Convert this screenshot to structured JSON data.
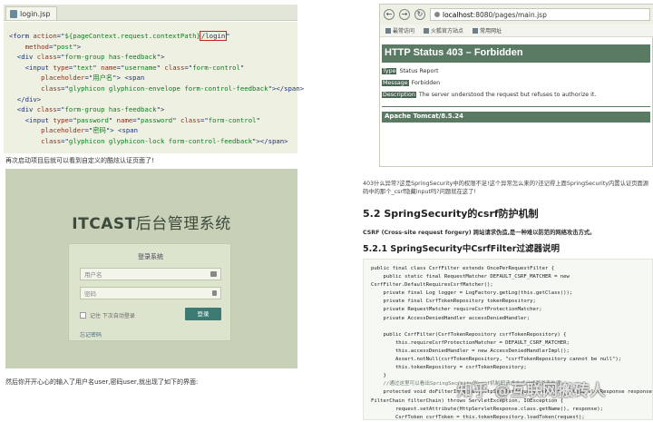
{
  "left": {
    "tab_label": "login.jsp",
    "code_lines": [
      {
        "indent": "",
        "tokens": [
          [
            "tag",
            "<form "
          ],
          [
            "attr",
            "action"
          ],
          [
            "tag",
            "=\""
          ],
          [
            "str",
            "${pageContext.request.contextPath}"
          ],
          [
            "hl",
            "/login"
          ],
          [
            "tag",
            "\""
          ]
        ]
      },
      {
        "indent": "    ",
        "tokens": [
          [
            "attr",
            "method"
          ],
          [
            "tag",
            "=\""
          ],
          [
            "str",
            "post"
          ],
          [
            "tag",
            "\">"
          ]
        ]
      },
      {
        "indent": "  ",
        "tokens": [
          [
            "tag",
            "<div "
          ],
          [
            "attr",
            "class"
          ],
          [
            "tag",
            "=\""
          ],
          [
            "str",
            "form-group has-feedback"
          ],
          [
            "tag",
            "\">"
          ]
        ]
      },
      {
        "indent": "    ",
        "tokens": [
          [
            "tag",
            "<input "
          ],
          [
            "attr",
            "type"
          ],
          [
            "tag",
            "=\""
          ],
          [
            "str",
            "text"
          ],
          [
            "tag",
            "\" "
          ],
          [
            "attr",
            "name"
          ],
          [
            "tag",
            "=\""
          ],
          [
            "str",
            "username"
          ],
          [
            "tag",
            "\" "
          ],
          [
            "attr",
            "class"
          ],
          [
            "tag",
            "=\""
          ],
          [
            "str",
            "form-control"
          ],
          [
            "tag",
            "\""
          ]
        ]
      },
      {
        "indent": "        ",
        "tokens": [
          [
            "attr",
            "placeholder"
          ],
          [
            "tag",
            "=\""
          ],
          [
            "str",
            "用户名"
          ],
          [
            "tag",
            "\"> <span"
          ]
        ]
      },
      {
        "indent": "        ",
        "tokens": [
          [
            "attr",
            "class"
          ],
          [
            "tag",
            "=\""
          ],
          [
            "str",
            "glyphicon glyphicon-envelope form-control-feedback"
          ],
          [
            "tag",
            "\"></span>"
          ]
        ]
      },
      {
        "indent": "  ",
        "tokens": [
          [
            "tag",
            "</div>"
          ]
        ]
      },
      {
        "indent": "  ",
        "tokens": [
          [
            "tag",
            "<div "
          ],
          [
            "attr",
            "class"
          ],
          [
            "tag",
            "=\""
          ],
          [
            "str",
            "form-group has-feedback"
          ],
          [
            "tag",
            "\">"
          ]
        ]
      },
      {
        "indent": "    ",
        "tokens": [
          [
            "tag",
            "<input "
          ],
          [
            "attr",
            "type"
          ],
          [
            "tag",
            "=\""
          ],
          [
            "str",
            "password"
          ],
          [
            "tag",
            "\" "
          ],
          [
            "attr",
            "name"
          ],
          [
            "tag",
            "=\""
          ],
          [
            "str",
            "password"
          ],
          [
            "tag",
            "\" "
          ],
          [
            "attr",
            "class"
          ],
          [
            "tag",
            "=\""
          ],
          [
            "str",
            "form-control"
          ],
          [
            "tag",
            "\""
          ]
        ]
      },
      {
        "indent": "        ",
        "tokens": [
          [
            "attr",
            "placeholder"
          ],
          [
            "tag",
            "=\""
          ],
          [
            "str",
            "密码"
          ],
          [
            "tag",
            "\"> <span"
          ]
        ]
      },
      {
        "indent": "        ",
        "tokens": [
          [
            "attr",
            "class"
          ],
          [
            "tag",
            "=\""
          ],
          [
            "str",
            "glyphicon glyphicon-lock form-control-feedback"
          ],
          [
            "tag",
            "\"></span>"
          ]
        ]
      }
    ],
    "caption_top": "再次启动项目后就可以看到自定义的酷炫认证页面了!",
    "login": {
      "brand_bold": "ITCAST",
      "brand_rest": "后台管理系统",
      "box_title": "登录系统",
      "username_placeholder": "用户名",
      "password_placeholder": "密码",
      "remember_label": "记住 下次自动登录",
      "login_button": "登录",
      "forgot_link": "忘记密码"
    },
    "caption_bottom": "然后你开开心心的输入了用户名user,密码user,就出现了如下的界面:"
  },
  "right": {
    "browser": {
      "back": "←",
      "forward": "→",
      "reload": "↻",
      "url_domain": "localhost",
      "url_rest": ":8080/pages/main.jsp",
      "bookmarks": [
        "最常访问",
        "火狐官方站点",
        "常用网址"
      ]
    },
    "error": {
      "title": "HTTP Status 403 – Forbidden",
      "type_label": "Type",
      "type_value": "Status Report",
      "message_label": "Message",
      "message_value": "Forbidden",
      "description_label": "Description",
      "description_value": "The server understood the request but refuses to authorize it.",
      "footer": "Apache Tomcat/8.5.24"
    },
    "paragraph": "403什么异常?这是SpringSecurity中的权限不足!这个异常怎么来的?还记得上面SpringSecurity内置认证页面源码中的那个_csrf隐藏input吗?问题就在这了!",
    "h52": "5.2 SpringSecurity的csrf防护机制",
    "csrf_def": "CSRF (Cross-site request forgery) 跨站请求伪造,是一种难以防范的网络攻击方式。",
    "h521": "5.2.1 SpringSecurity中CsrfFilter过滤器说明",
    "java_lines": [
      "public final class CsrfFilter extends OncePerRequestFilter {",
      "    public static final RequestMatcher DEFAULT_CSRF_MATCHER = new",
      "CsrfFilter.DefaultRequiresCsrfMatcher();",
      "    private final Log logger = LogFactory.getLog(this.getClass());",
      "    private final CsrfTokenRepository tokenRepository;",
      "    private RequestMatcher requireCsrfProtectionMatcher;",
      "    private AccessDeniedHandler accessDeniedHandler;",
      "",
      "    public CsrfFilter(CsrfTokenRepository csrfTokenRepository) {",
      "        this.requireCsrfProtectionMatcher = DEFAULT_CSRF_MATCHER;",
      "        this.accessDeniedHandler = new AccessDeniedHandlerImpl();",
      "        Assert.notNull(csrfTokenRepository, \"csrfTokenRepository cannot be null\");",
      "        this.tokenRepository = csrfTokenRepository;",
      "    }",
      "    //通过这里可以看出SpringSecurity的csrf机制把请求方式分成两类来处理",
      "    protected void doFilterInternal(HttpServletRequest request, HttpServletResponse response,",
      "FilterChain filterChain) throws ServletException, IOException {",
      "        request.setAttribute(HttpServletResponse.class.getName(), response);",
      "        CsrfToken csrfToken = this.tokenRepository.loadToken(request);"
    ]
  },
  "watermark": "知乎 @互联网搬砖人"
}
